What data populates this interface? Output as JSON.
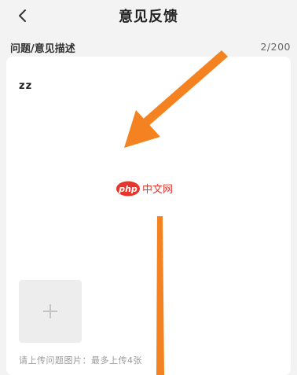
{
  "header": {
    "title": "意见反馈",
    "back_icon": "chevron-left-icon"
  },
  "form": {
    "section_label": "问题/意见描述",
    "char_count": "2/200",
    "description_value": "zz",
    "upload_icon": "plus-icon",
    "upload_hint": "请上传问题图片：最多上传4张"
  },
  "watermark": {
    "php_text": "php",
    "cn_text": "中文网",
    "brand_color": "#e8342b"
  },
  "annotation": {
    "arrow_color": "#f58220"
  }
}
